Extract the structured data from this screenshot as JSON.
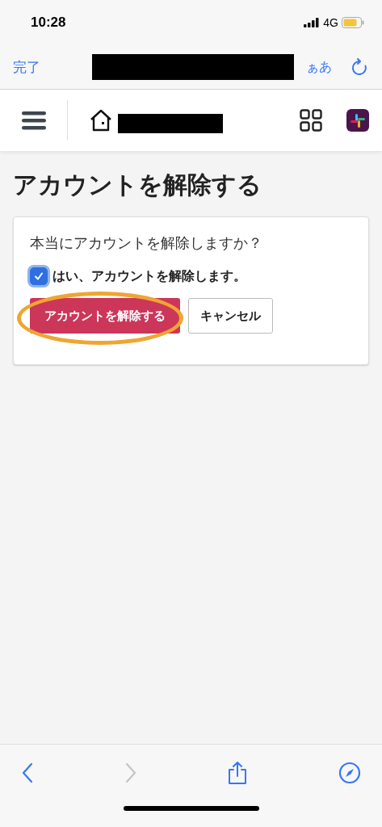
{
  "status_bar": {
    "time": "10:28",
    "network": "4G"
  },
  "browser_bar": {
    "done": "完了",
    "address_redacted": true,
    "text_size": "ぁあ"
  },
  "site_header": {
    "name_redacted": true
  },
  "page": {
    "title": "アカウントを解除する",
    "card": {
      "question": "本当にアカウントを解除しますか？",
      "confirm": {
        "label": "はい、アカウントを解除します。",
        "checked": true
      },
      "buttons": [
        {
          "kind": "danger",
          "label": "アカウントを解除する",
          "highlighted": true
        },
        {
          "kind": "plain",
          "label": "キャンセル",
          "highlighted": false
        }
      ]
    }
  },
  "toolbar": [
    {
      "kind": "back",
      "disabled": false
    },
    {
      "kind": "forward",
      "disabled": true
    },
    {
      "kind": "share",
      "disabled": false
    },
    {
      "kind": "compass",
      "disabled": false
    }
  ]
}
